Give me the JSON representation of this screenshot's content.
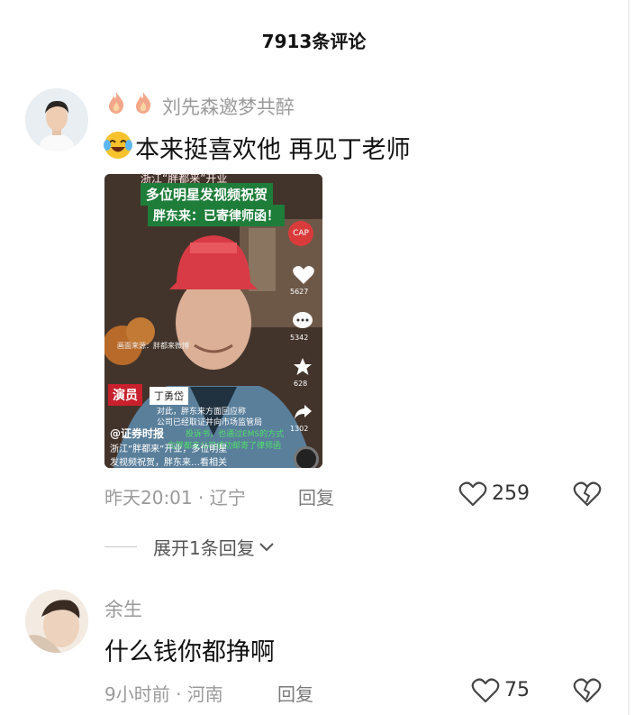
{
  "header": {
    "title": "7913条评论"
  },
  "comments": [
    {
      "username": "刘先森邀梦共醉",
      "text": "本来挺喜欢他 再见丁老师",
      "time_location": "昨天20:01 · 辽宁",
      "reply_label": "回复",
      "likes": "259",
      "video": {
        "banner_top": "浙江“胖都来”开业",
        "banner_line1": "多位明星发视频祝贺",
        "banner_line2": "胖东来：已寄律师函！",
        "cap_logo": "CAP",
        "image_source": "画面来源：胖都来微博",
        "name_tag_role": "演员",
        "name_tag_name": "丁勇岱",
        "subtitle1": "对此，胖东来方面回应称",
        "subtitle2": "公司已经取证并向市场监管局",
        "subtitle3": "投诉书，也通过EMS的方式",
        "subtitle4": "向胖都来公司成功邮寄了律师函",
        "source_tag": "@证券时报",
        "caption1": "浙江“胖都来”开业，多位明星",
        "caption2": "发视频祝贺，胖东来…看相关",
        "side_likes": "5627",
        "side_comments": "5342",
        "side_favs": "628",
        "side_shares": "1302"
      }
    },
    {
      "username": "余生",
      "text": "什么钱你都挣啊",
      "time_location": "9小时前 · 河南",
      "reply_label": "回复",
      "likes": "75"
    }
  ],
  "expand_replies": "展开1条回复"
}
